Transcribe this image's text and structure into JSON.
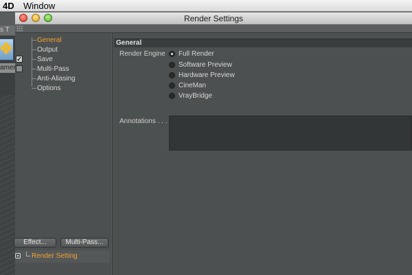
{
  "menubar": {
    "app": "4D",
    "window_menu": "Window"
  },
  "background_app": {
    "tab_fragment": "s T",
    "label_fragment": "amer"
  },
  "window": {
    "title": "Render Settings"
  },
  "nav": {
    "items": [
      {
        "label": "General",
        "active": true,
        "checkbox": null
      },
      {
        "label": "Output",
        "active": false,
        "checkbox": null
      },
      {
        "label": "Save",
        "active": false,
        "checkbox": "checked"
      },
      {
        "label": "Multi-Pass",
        "active": false,
        "checkbox": "unchecked"
      },
      {
        "label": "Anti-Aliasing",
        "active": false,
        "checkbox": null
      },
      {
        "label": "Options",
        "active": false,
        "checkbox": null
      }
    ],
    "check_mark": "✓"
  },
  "buttons": {
    "effect": "Effect...",
    "multipass": "Multi-Pass..."
  },
  "settings_list": {
    "item": "Render Setting"
  },
  "general": {
    "header": "General",
    "render_engine_label": "Render Engine",
    "options": [
      "Full Render",
      "Software Preview",
      "Hardware Preview",
      "CineMan",
      "VrayBridge"
    ],
    "selected": "Full Render",
    "annotations_label": "Annotations . . . ."
  },
  "colors": {
    "accent": "#f0a030",
    "panel": "#4d5050",
    "header": "#3b3e3e"
  }
}
